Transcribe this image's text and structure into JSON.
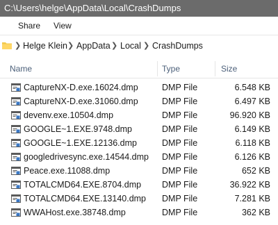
{
  "window": {
    "title": "C:\\Users\\helge\\AppData\\Local\\CrashDumps"
  },
  "ribbon": {
    "tabs": [
      "Share",
      "View"
    ]
  },
  "address": {
    "folder_icon": "folder-icon",
    "crumbs": [
      "Helge Klein",
      "AppData",
      "Local",
      "CrashDumps"
    ]
  },
  "columns": {
    "name": "Name",
    "type": "Type",
    "size": "Size"
  },
  "files": [
    {
      "name": "CaptureNX-D.exe.16024.dmp",
      "type": "DMP File",
      "size": "6.548 KB"
    },
    {
      "name": "CaptureNX-D.exe.31060.dmp",
      "type": "DMP File",
      "size": "6.497 KB"
    },
    {
      "name": "devenv.exe.10504.dmp",
      "type": "DMP File",
      "size": "96.920 KB"
    },
    {
      "name": "GOOGLE~1.EXE.9748.dmp",
      "type": "DMP File",
      "size": "6.149 KB"
    },
    {
      "name": "GOOGLE~1.EXE.12136.dmp",
      "type": "DMP File",
      "size": "6.118 KB"
    },
    {
      "name": "googledrivesync.exe.14544.dmp",
      "type": "DMP File",
      "size": "6.126 KB"
    },
    {
      "name": "Peace.exe.11088.dmp",
      "type": "DMP File",
      "size": "652 KB"
    },
    {
      "name": "TOTALCMD64.EXE.8704.dmp",
      "type": "DMP File",
      "size": "36.922 KB"
    },
    {
      "name": "TOTALCMD64.EXE.13140.dmp",
      "type": "DMP File",
      "size": "7.281 KB"
    },
    {
      "name": "WWAHost.exe.38748.dmp",
      "type": "DMP File",
      "size": "362 KB"
    }
  ],
  "file_icon": "dmp-file-icon"
}
